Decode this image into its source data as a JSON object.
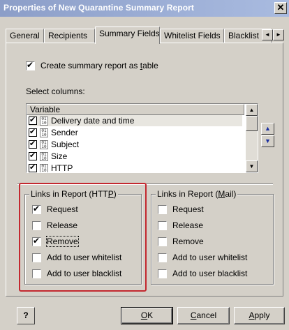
{
  "window": {
    "title": "Properties of New Quarantine Summary Report",
    "close_glyph": "✕"
  },
  "tabs": [
    {
      "label": "General",
      "active": false
    },
    {
      "label": "Recipients",
      "active": false
    },
    {
      "label": "Summary Fields",
      "active": true
    },
    {
      "label": "Whitelist Fields",
      "active": false
    },
    {
      "label": "Blacklist Field",
      "active": false
    }
  ],
  "tab_scroll": {
    "left_glyph": "◄",
    "right_glyph": "►"
  },
  "summary": {
    "create_table": {
      "label_pre": "Create summary report as ",
      "label_accel": "t",
      "label_post": "able",
      "checked": true
    },
    "select_columns_label": "Select columns:",
    "column_header": "Variable",
    "columns": [
      {
        "label": "Delivery date and time",
        "checked": true,
        "selected": true
      },
      {
        "label": "Sender",
        "checked": true,
        "selected": false
      },
      {
        "label": "Subject",
        "checked": true,
        "selected": false
      },
      {
        "label": "Size",
        "checked": true,
        "selected": false
      },
      {
        "label": "HTTP",
        "checked": true,
        "selected": false
      }
    ],
    "field_icon_text": "01 10",
    "move_up_glyph": "▲",
    "move_down_glyph": "▼",
    "scroll_up_glyph": "▲",
    "scroll_down_glyph": "▼"
  },
  "links_http": {
    "title_pre": "Links in Report (HTT",
    "title_accel": "P",
    "title_post": ")",
    "options": [
      {
        "label": "Request",
        "checked": true
      },
      {
        "label": "Release",
        "checked": false
      },
      {
        "label": "Remove",
        "checked": true
      },
      {
        "label": "Add to user whitelist",
        "checked": false
      },
      {
        "label": "Add to user blacklist",
        "checked": false
      }
    ]
  },
  "links_mail": {
    "title_pre": "Links in Report (",
    "title_accel": "M",
    "title_post": "ail)",
    "options": [
      {
        "label": "Request",
        "checked": false
      },
      {
        "label": "Release",
        "checked": false
      },
      {
        "label": "Remove",
        "checked": false
      },
      {
        "label": "Add to user whitelist",
        "checked": false
      },
      {
        "label": "Add to user blacklist",
        "checked": false
      }
    ]
  },
  "buttons": {
    "ok": {
      "accel": "O",
      "rest": "K"
    },
    "cancel": {
      "accel": "C",
      "rest": "ancel"
    },
    "apply": {
      "accel": "A",
      "rest": "pply"
    },
    "help_glyph": "?"
  },
  "colors": {
    "titlebar_start": "#8c9ec8",
    "titlebar_end": "#a9bbe0",
    "highlight_box": "#c3282f",
    "dialog_face": "#d4d0c8"
  }
}
